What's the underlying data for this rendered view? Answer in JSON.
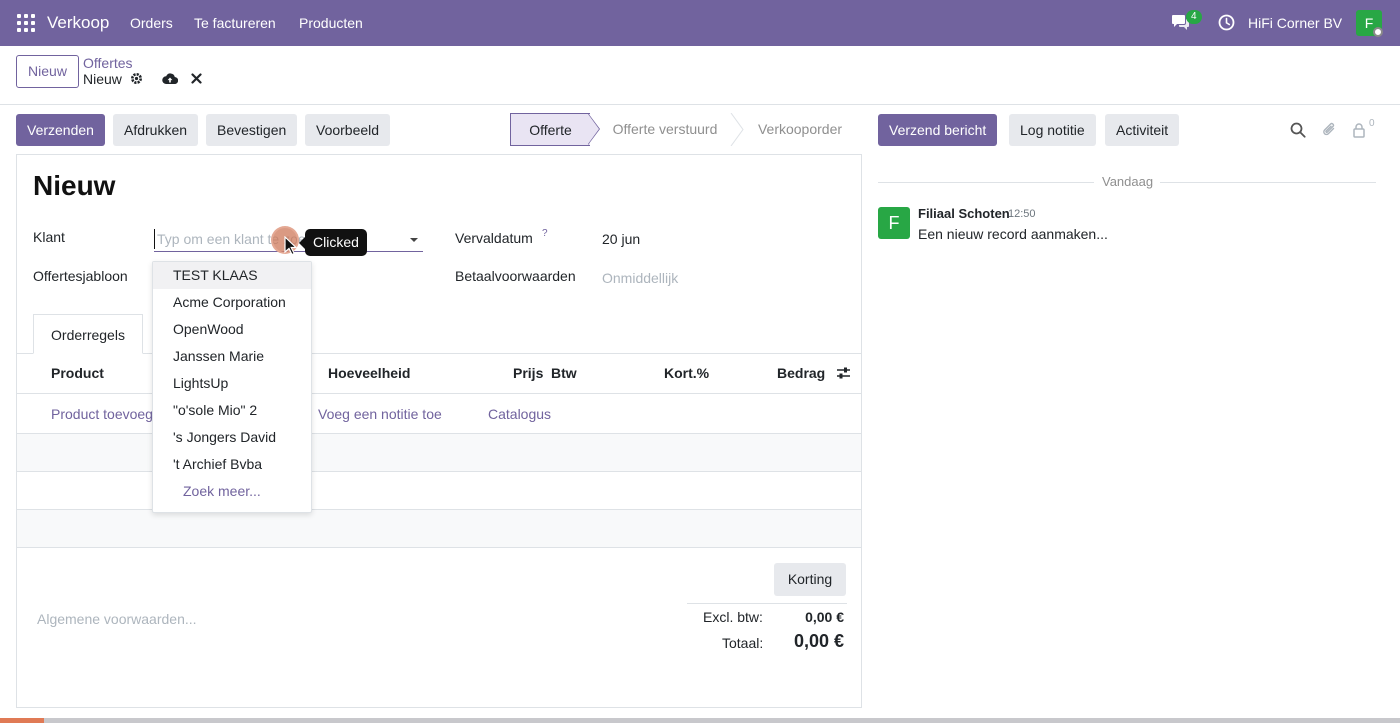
{
  "navbar": {
    "app_name": "Verkoop",
    "menu": [
      "Orders",
      "Te factureren",
      "Producten"
    ],
    "chat_count": "4",
    "company": "HiFi Corner BV",
    "avatar_letter": "F",
    "colors": {
      "brand": "#71639e",
      "avatar": "#28a745"
    }
  },
  "control_panel": {
    "new_button": "Nieuw",
    "breadcrumb_parent": "Offertes",
    "breadcrumb_current": "Nieuw"
  },
  "actions": {
    "send": "Verzenden",
    "print": "Afdrukken",
    "confirm": "Bevestigen",
    "preview": "Voorbeeld"
  },
  "statusbar": {
    "stages": [
      "Offerte",
      "Offerte verstuurd",
      "Verkooporder"
    ],
    "active_stage": "Offerte"
  },
  "form": {
    "title": "Nieuw",
    "customer_label": "Klant",
    "customer_placeholder": "Typ om een klant te zoeken...",
    "template_label": "Offertesjabloon",
    "expiration_label": "Vervaldatum",
    "expiration_help": "?",
    "expiration_value": "20 jun",
    "payment_terms_label": "Betaalvoorwaarden",
    "payment_terms_placeholder": "Onmiddellijk"
  },
  "tabs": {
    "order_lines": "Orderregels"
  },
  "order_table": {
    "headers": [
      "Product",
      "Hoeveelheid",
      "Prijs",
      "Btw",
      "Kort.%",
      "Bedrag"
    ],
    "add_product": "Product toevoegen",
    "add_note": "Voeg een notitie toe",
    "catalog": "Catalogus"
  },
  "totals": {
    "discount_button": "Korting",
    "terms_placeholder": "Algemene voorwaarden...",
    "untaxed_label": "Excl. btw:",
    "untaxed_value": "0,00 €",
    "total_label": "Totaal:",
    "total_value": "0,00 €"
  },
  "dropdown": {
    "items": [
      "TEST KLAAS",
      "Acme Corporation",
      "OpenWood",
      "Janssen Marie",
      "LightsUp",
      "\"o'sole Mio\" 2",
      "'s Jongers David",
      "'t Archief Bvba"
    ],
    "search_more": "Zoek meer..."
  },
  "click_tooltip": "Clicked",
  "chatter": {
    "send_message": "Verzend bericht",
    "log_note": "Log notitie",
    "activity": "Activiteit",
    "follower_count": "0",
    "day_separator": "Vandaag",
    "message": {
      "avatar_letter": "F",
      "author": "Filiaal Schoten",
      "time": "12:50",
      "body": "Een nieuw record aanmaken..."
    }
  }
}
